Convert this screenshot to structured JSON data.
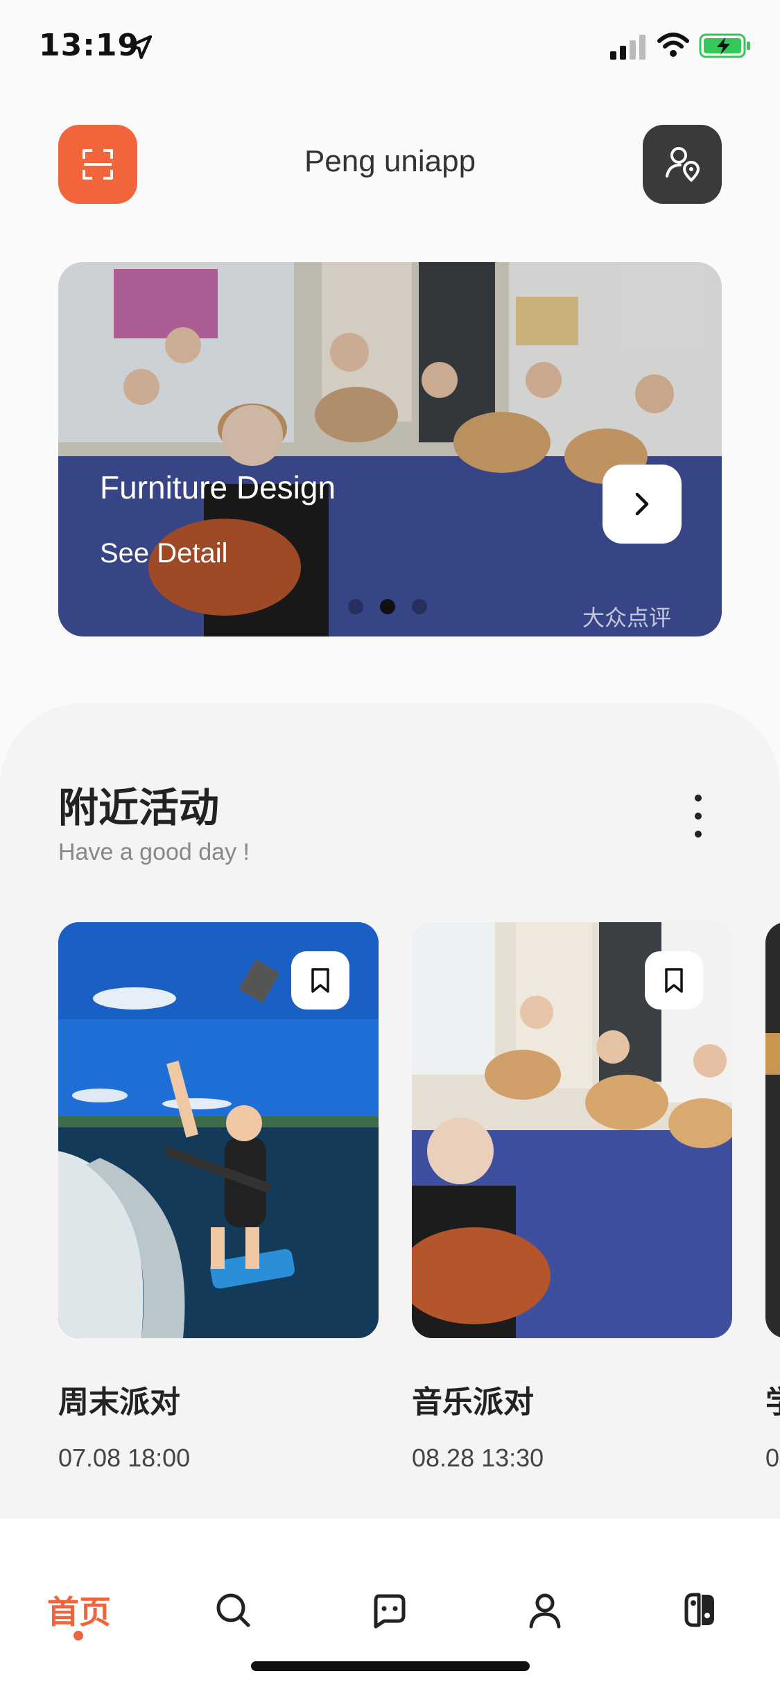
{
  "status": {
    "time": "13:19"
  },
  "header": {
    "title": "Peng uniapp"
  },
  "banner": {
    "title": "Furniture Design",
    "subtitle": "See Detail",
    "watermark": "大众点评",
    "active_slide": 2,
    "slide_count": 3
  },
  "section": {
    "title": "附近活动",
    "subtitle": "Have a good day !",
    "cards": [
      {
        "title": "周末派对",
        "date": "07.08 18:00"
      },
      {
        "title": "音乐派对",
        "date": "08.28 13:30"
      },
      {
        "title": "学",
        "date": "0"
      }
    ]
  },
  "tabbar": {
    "home_label": "首页",
    "accent": "#f2643b",
    "icons": [
      "search-icon",
      "chat-icon",
      "user-icon",
      "switch-icon"
    ]
  }
}
